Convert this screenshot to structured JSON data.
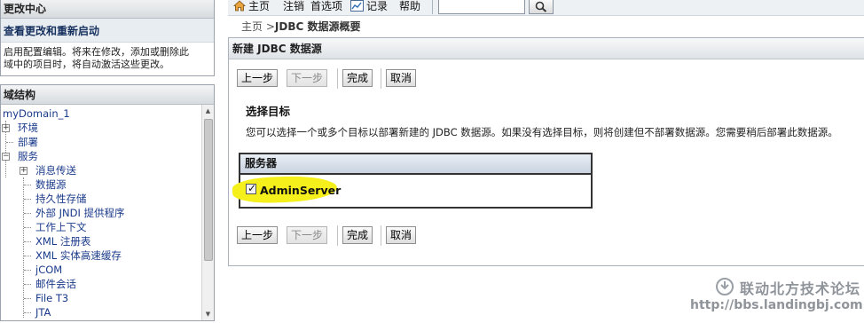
{
  "change_center": {
    "title": "更改中心",
    "link": "查看更改和重新启动",
    "description_line1": "启用配置编辑。将来在修改，添加或删除此",
    "description_line2": "域中的项目时，将自动激活这些更改。"
  },
  "domain_structure": {
    "title": "域结构",
    "tree": {
      "root": "myDomain_1",
      "environment": "环境",
      "deployments": "部署",
      "services": "服务",
      "messaging": "消息传送",
      "data_sources": "数据源",
      "persistent_stores": "持久性存储",
      "foreign_jndi": "外部 JNDI 提供程序",
      "work_contexts": "工作上下文",
      "xml_registries": "XML 注册表",
      "xml_entity_caches": "XML 实体高速缓存",
      "jcom": "jCOM",
      "mail_sessions": "邮件会话",
      "file_t3": "File T3",
      "jta": "JTA"
    }
  },
  "toolbar": {
    "home": "主页",
    "logout": "注销",
    "preferences": "首选项",
    "record": "记录",
    "help": "帮助",
    "search_value": ""
  },
  "breadcrumb": {
    "home": "主页",
    "separator": " >",
    "current": "JDBC 数据源概要"
  },
  "main": {
    "title": "新建 JDBC 数据源",
    "buttons": {
      "back": "上一步",
      "next": "下一步",
      "finish": "完成",
      "cancel": "取消"
    },
    "section_title": "选择目标",
    "section_description": "您可以选择一个或多个目标以部署新建的 JDBC 数据源。如果没有选择目标，则将创建但不部署数据源。您需要稍后部署此数据源。",
    "servers_header": "服务器",
    "servers": [
      {
        "name": "AdminServer",
        "checked": true
      }
    ]
  },
  "watermark": {
    "name": "联动北方技术论坛",
    "url": "http://bbs.landingbj.com"
  },
  "colors": {
    "highlight": "#f5f01b",
    "tree_link": "#1a3a8a",
    "change_center_link": "#16305e"
  }
}
